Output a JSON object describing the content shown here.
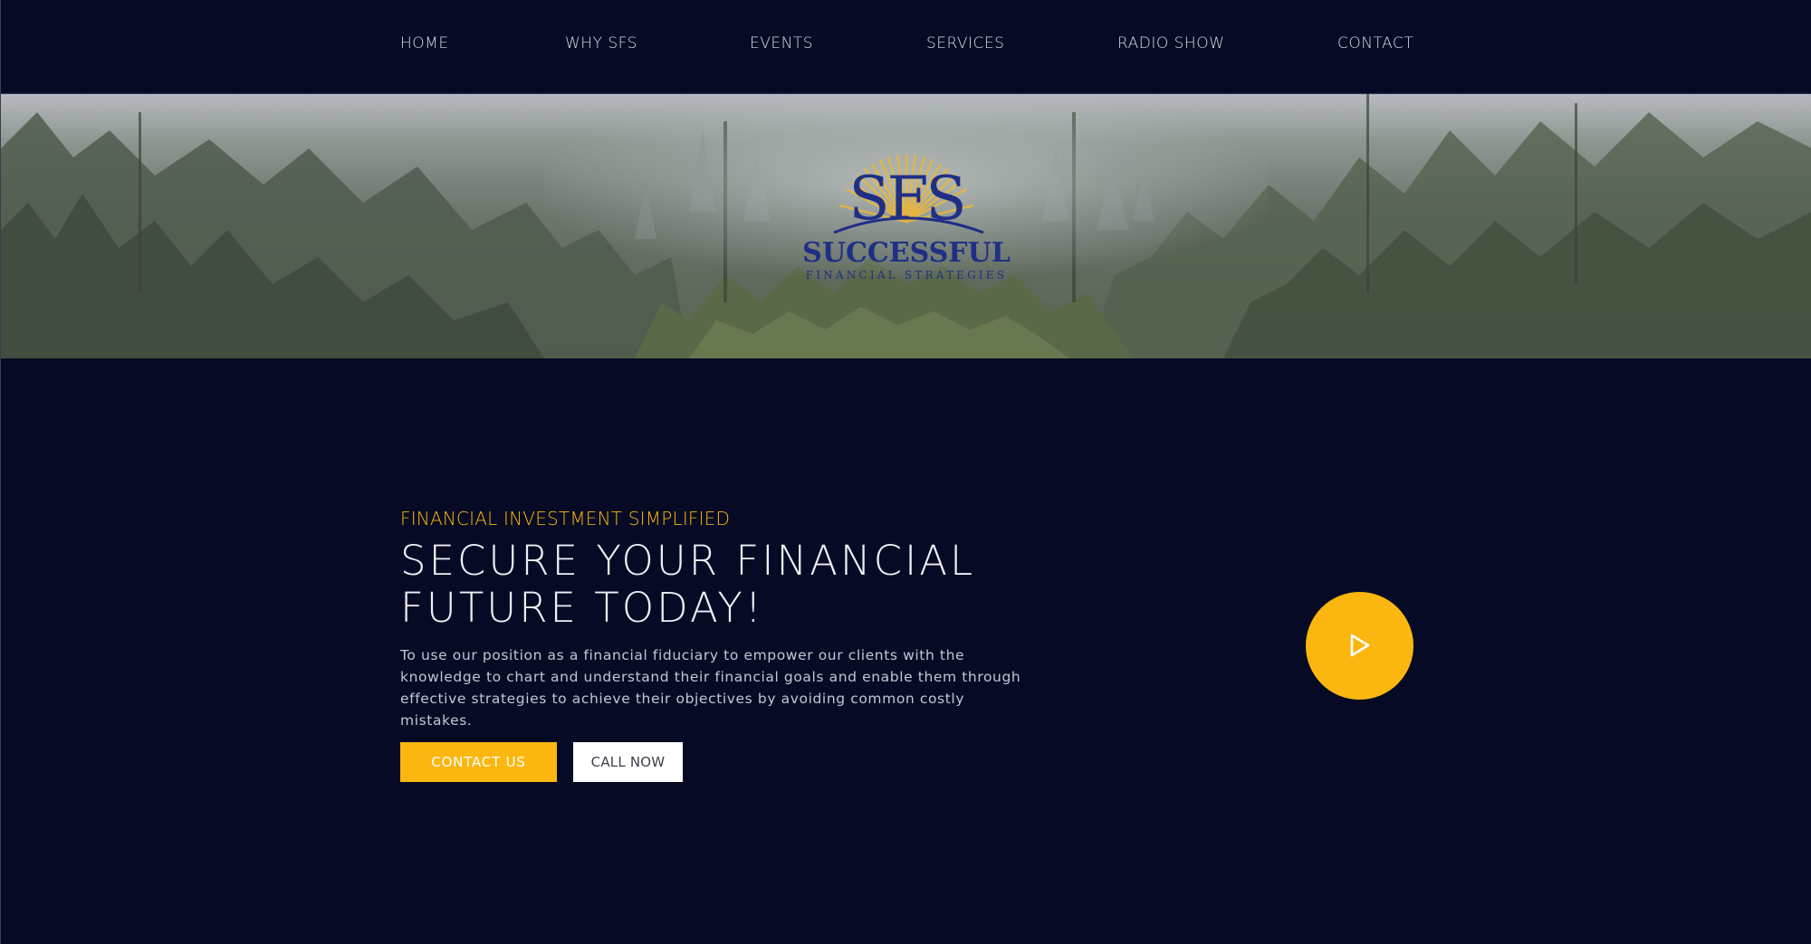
{
  "nav": {
    "items": [
      {
        "label": "HOME"
      },
      {
        "label": "WHY SFS"
      },
      {
        "label": "EVENTS"
      },
      {
        "label": "SERVICES"
      },
      {
        "label": "RADIO SHOW"
      },
      {
        "label": "CONTACT"
      }
    ]
  },
  "logo": {
    "mark": "SFS",
    "name": "SUCCESSFUL",
    "tagline": "FINANCIAL STRATEGIES"
  },
  "hero": {
    "eyebrow": "FINANCIAL INVESTMENT SIMPLIFIED",
    "headline_line1": "SECURE YOUR FINANCIAL",
    "headline_line2": "FUTURE TODAY!",
    "description": "To use our position as a financial fiduciary to empower our clients with the knowledge to chart and understand their financial goals and enable them through effective strategies to achieve their objectives by avoiding common costly mistakes.",
    "primary_button": "CONTACT US",
    "secondary_button": "CALL NOW",
    "video_icon": "play-icon"
  },
  "colors": {
    "background": "#070a24",
    "accent": "#fbb710",
    "logo_blue": "#1f2f86",
    "logo_gold": "#e9b73c"
  }
}
